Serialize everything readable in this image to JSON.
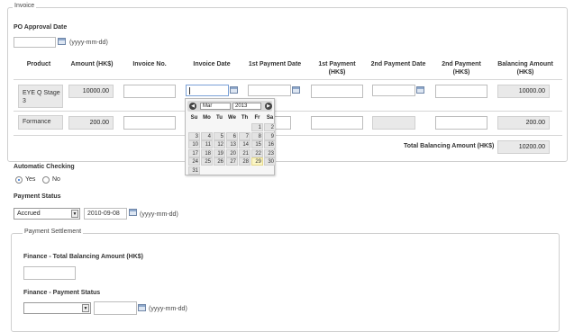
{
  "invoice": {
    "legend": "Invoice",
    "po_approval_label": "PO Approval Date",
    "po_approval_value": "",
    "date_hint": "(yyyy-mm-dd)",
    "columns": [
      "Product",
      "Amount (HK$)",
      "Invoice No.",
      "Invoice Date",
      "1st Payment Date",
      "1st Payment (HK$)",
      "2nd Payment Date",
      "2nd Payment (HK$)",
      "Balancing Amount (HK$)"
    ],
    "rows": [
      {
        "product": "EYE Q Stage 3",
        "amount": "10000.00",
        "invoice_no": "",
        "invoice_date": "",
        "payment1_date": "",
        "payment1": "",
        "payment2_date": "",
        "payment2": "",
        "balancing": "10000.00"
      },
      {
        "product": "Formance",
        "amount": "200.00",
        "invoice_no": "",
        "invoice_date": "",
        "payment1_date": "",
        "payment1": "",
        "payment2_date": "",
        "payment2": "",
        "balancing": "200.00"
      }
    ],
    "total_label": "Total Balancing Amount (HK$)",
    "total_value": "10200.00"
  },
  "calendar": {
    "month": "Mar",
    "year": "2013",
    "weekdays": [
      "Su",
      "Mo",
      "Tu",
      "We",
      "Th",
      "Fr",
      "Sa"
    ],
    "weeks": [
      [
        "",
        "",
        "",
        "",
        "",
        "1",
        "2"
      ],
      [
        "3",
        "4",
        "5",
        "6",
        "7",
        "8",
        "9"
      ],
      [
        "10",
        "11",
        "12",
        "13",
        "14",
        "15",
        "16"
      ],
      [
        "17",
        "18",
        "19",
        "20",
        "21",
        "22",
        "23"
      ],
      [
        "24",
        "25",
        "26",
        "27",
        "28",
        "29",
        "30"
      ],
      [
        "31",
        "",
        "",
        "",
        "",
        "",
        ""
      ]
    ],
    "highlighted_day": "29",
    "prev_icon": "prev-month-icon",
    "next_icon": "next-month-icon"
  },
  "automatic_checking": {
    "label": "Automatic Checking",
    "options": [
      "Yes",
      "No"
    ],
    "selected": "Yes"
  },
  "payment_status": {
    "label": "Payment Status",
    "selected": "Accrued",
    "date_value": "2010-09-08",
    "date_hint": "(yyyy-mm-dd)"
  },
  "payment_settlement": {
    "legend": "Payment Settlement",
    "finance_total_label": "Finance - Total Balancing Amount (HK$)",
    "finance_total_value": "",
    "finance_status_label": "Finance - Payment Status",
    "finance_status_selected": "",
    "finance_date_value": "",
    "date_hint": "(yyyy-mm-dd)"
  }
}
